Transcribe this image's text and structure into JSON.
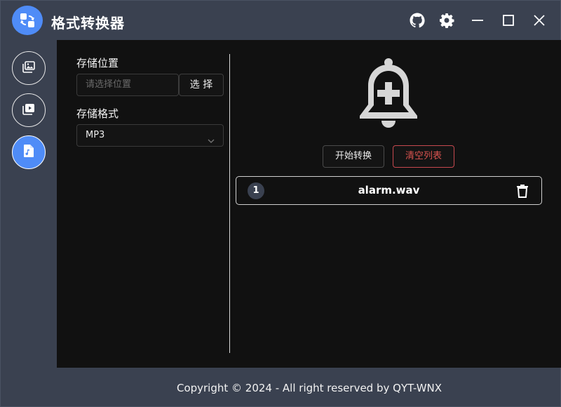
{
  "app": {
    "title": "格式转换器",
    "icon": "swap-arrows-icon",
    "accent": "#4f8cf7"
  },
  "titlebar": {
    "actions": [
      "github-icon",
      "gear-icon",
      "minimize-icon",
      "maximize-icon",
      "close-icon"
    ]
  },
  "nav": {
    "items": [
      {
        "name": "image-convert",
        "icon": "images-icon",
        "active": false
      },
      {
        "name": "video-convert",
        "icon": "video-icon",
        "active": false
      },
      {
        "name": "audio-convert",
        "icon": "music-file-icon",
        "active": true
      }
    ]
  },
  "settings": {
    "storage_location_label": "存储位置",
    "storage_location_placeholder": "请选择位置",
    "select_button": "选 择",
    "storage_format_label": "存储格式",
    "storage_format_value": "MP3"
  },
  "actions": {
    "start_label": "开始转换",
    "clear_label": "清空列表",
    "clear_color": "#d9534f"
  },
  "files": [
    {
      "index": "1",
      "name": "alarm.wav"
    }
  ],
  "footer": {
    "copyright": "Copyright © 2024 - All right reserved by QYT-WNX"
  }
}
